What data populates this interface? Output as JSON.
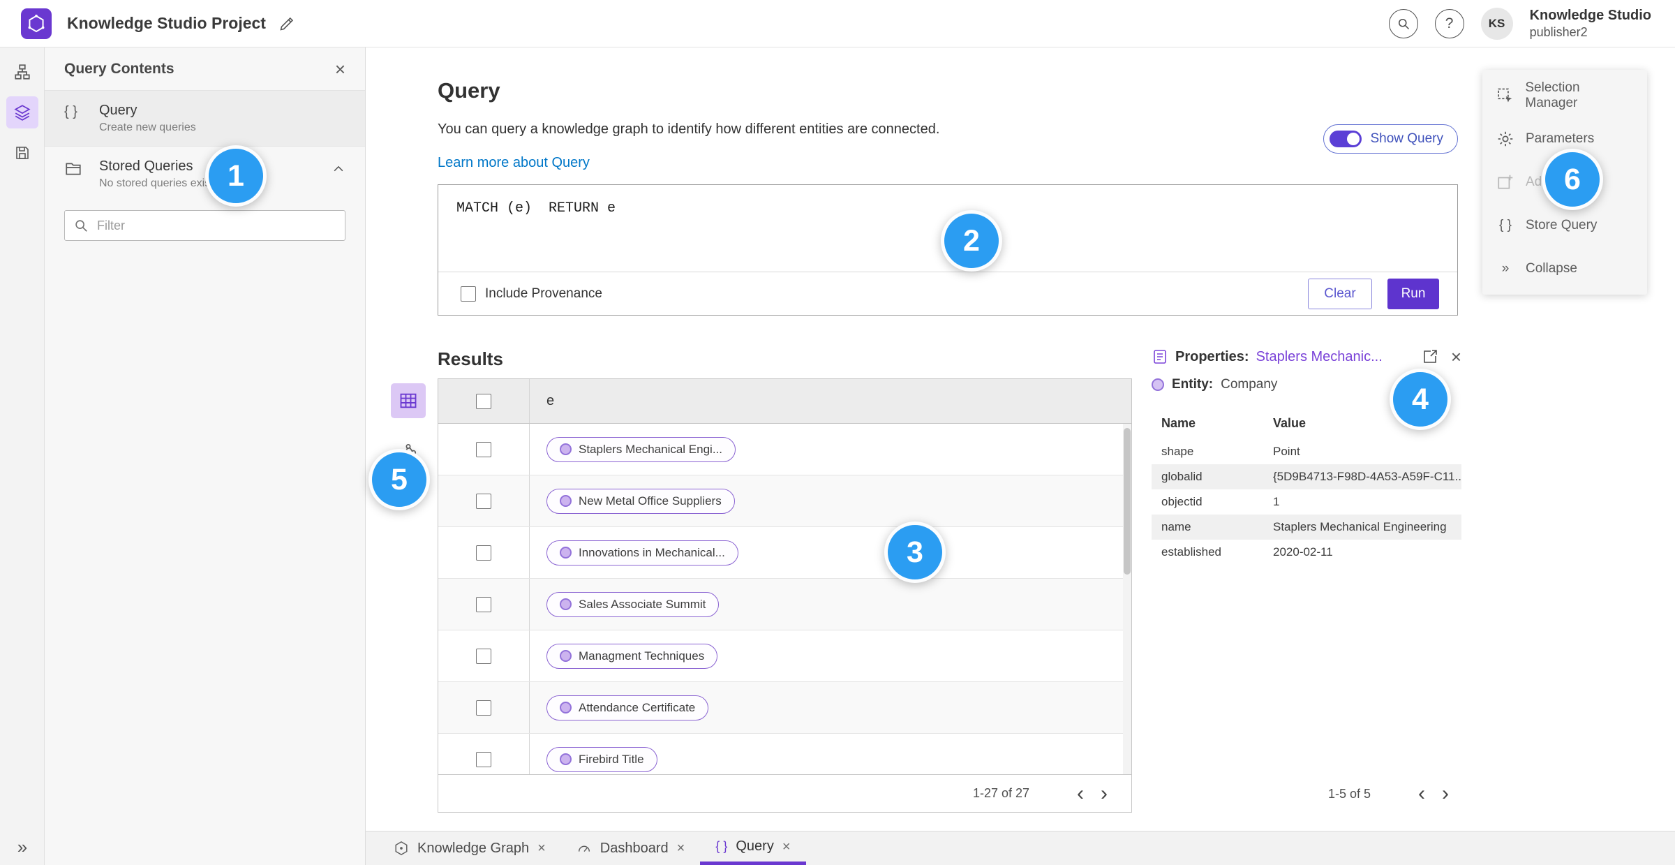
{
  "header": {
    "app_title": "Knowledge Studio Project",
    "user_org": "Knowledge Studio",
    "user_name": "publisher2",
    "avatar_initials": "KS"
  },
  "contents_panel": {
    "title": "Query Contents",
    "query_item": {
      "title": "Query",
      "subtitle": "Create new queries"
    },
    "stored_item": {
      "title": "Stored Queries",
      "subtitle": "No stored queries exist"
    },
    "filter_placeholder": "Filter"
  },
  "query_section": {
    "title": "Query",
    "description": "You can query a knowledge graph to identify how different entities are connected.",
    "learn_more_link": "Learn more about Query",
    "show_query_label": "Show Query",
    "query_text": "MATCH (e)  RETURN e",
    "include_provenance_label": "Include Provenance",
    "clear_button": "Clear",
    "run_button": "Run"
  },
  "results": {
    "title": "Results",
    "column_header": "e",
    "rows": [
      "Staplers Mechanical Engi...",
      "New Metal Office Suppliers",
      "Innovations in Mechanical...",
      "Sales Associate Summit",
      "Managment Techniques",
      "Attendance Certificate",
      "Firebird Title"
    ],
    "pagination": "1-27 of 27"
  },
  "properties_panel": {
    "title": "Properties:",
    "entity_link": "Staplers Mechanic...",
    "entity_label": "Entity:",
    "entity_value": "Company",
    "col_name": "Name",
    "col_value": "Value",
    "rows": [
      {
        "name": "shape",
        "value": "Point"
      },
      {
        "name": "globalid",
        "value": "{5D9B4713-F98D-4A53-A59F-C11..."
      },
      {
        "name": "objectid",
        "value": "1"
      },
      {
        "name": "name",
        "value": "Staplers Mechanical Engineering"
      },
      {
        "name": "established",
        "value": "2020-02-11"
      }
    ],
    "pagination": "1-5 of 5"
  },
  "tools_menu": {
    "items": [
      {
        "label": "Selection Manager"
      },
      {
        "label": "Parameters"
      },
      {
        "label": "Add To Map"
      },
      {
        "label": "Store Query"
      },
      {
        "label": "Collapse"
      }
    ]
  },
  "tab_bar": {
    "tabs": [
      {
        "label": "Knowledge Graph"
      },
      {
        "label": "Dashboard"
      },
      {
        "label": "Query"
      }
    ]
  },
  "annotations": {
    "badges": [
      "1",
      "2",
      "3",
      "4",
      "5",
      "6"
    ]
  },
  "icons": {
    "close": "×",
    "chevron_left": "‹",
    "chevron_right": "›",
    "collapse": "»",
    "expand": "»",
    "braces": "{ }",
    "help": "?"
  },
  "colors": {
    "accent_purple": "#6a38d0",
    "badge_blue": "#2b9df2",
    "link_blue": "#0077c8",
    "pill_border_purple": "#8a63d2"
  }
}
